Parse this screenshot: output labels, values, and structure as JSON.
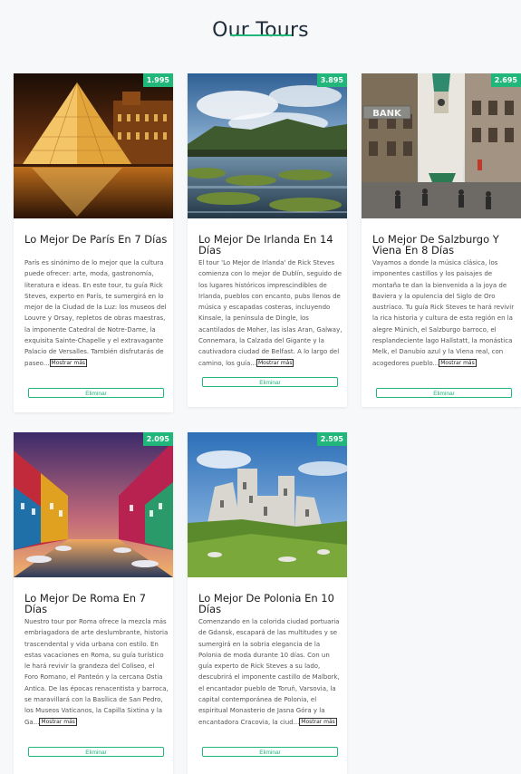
{
  "header": {
    "title": "Our Tours"
  },
  "tours": [
    {
      "price": "1.995",
      "title": "Lo Mejor De París En 7 Días",
      "description": "París es sinónimo de lo mejor que la cultura puede ofrecer: arte, moda, gastronomía, literatura e ideas. En este tour, tu guía Rick Steves, experto en París, te sumergirá en lo mejor de la Ciudad de la Luz: los museos del Louvre y Orsay, repletos de obras maestras, la imponente Catedral de Notre-Dame, la exquisita Sainte-Chapelle y el extravagante Palacio de Versalles. También disfrutarás de paseo...",
      "more_label": "Mostrar más",
      "remove_label": "Eliminar"
    },
    {
      "price": "3.895",
      "title": "Lo Mejor De Irlanda En 14 Días",
      "description": "El tour 'Lo Mejor de Irlanda' de Rick Steves comienza con lo mejor de Dublín, seguido de los lugares históricos imprescindibles de Irlanda, pueblos con encanto, pubs llenos de música y escapadas costeras, incluyendo Kinsale, la península de Dingle, los acantilados de Moher, las islas Aran, Galway, Connemara, la Calzada del Gigante y la cautivadora ciudad de Belfast. A lo largo del camino, los guía...",
      "more_label": "Mostrar más",
      "remove_label": "Eliminar"
    },
    {
      "price": "2.695",
      "title": "Lo Mejor De Salzburgo Y Viena En 8 Días",
      "description": "Vayamos a donde la música clásica, los imponentes castillos y los paisajes de montaña te dan la bienvenida a la joya de Baviera y la opulencia del Siglo de Oro austríaco. Tu guía Rick Steves te hará revivir la rica historia y cultura de esta región en la alegre Múnich, el Salzburgo barroco, el resplandeciente lago Hallstatt, la monástica Melk, el Danubio azul y la Viena real, con acogedores pueblo...",
      "more_label": "Mostrar más",
      "remove_label": "Eliminar"
    },
    {
      "price": "2.095",
      "title": "Lo Mejor De Roma En 7 Días",
      "description": "Nuestro tour por Roma ofrece la mezcla más embriagadora de arte deslumbrante, historia trascendental y vida urbana con estilo. En estas vacaciones en Roma, su guía turístico le hará revivir la grandeza del Coliseo, el Foro Romano, el Panteón y la cercana Ostia Antica. De las épocas renacentista y barroca, se maravillará con la Basílica de San Pedro, los Museos Vaticanos, la Capilla Sixtina y la Ga...",
      "more_label": "Mostrar más",
      "remove_label": "Eliminar"
    },
    {
      "price": "2.595",
      "title": "Lo Mejor De Polonia En 10 Días",
      "description": "Comenzando en la colorida ciudad portuaria de Gdansk, escapará de las multitudes y se sumergirá en la sobria elegancia de la Polonia de moda durante 10 días. Con un guía experto de Rick Steves a su lado, descubrirá el imponente castillo de Malbork, el encantador pueblo de Toruń, Varsovia, la capital contemporánea de Polonia, el espiritual Monasterio de Jasna Góra y la encantadora Cracovia, la ciud...",
      "more_label": "Mostrar más",
      "remove_label": "Eliminar"
    }
  ]
}
